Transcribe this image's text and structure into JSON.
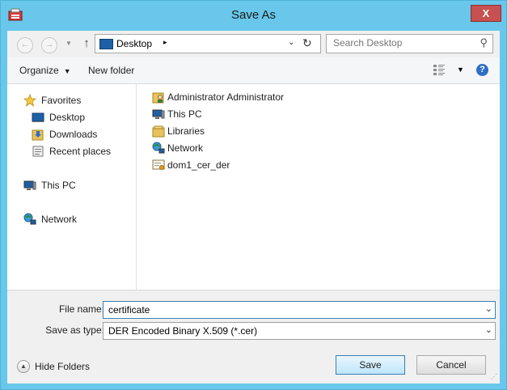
{
  "window": {
    "title": "Save As",
    "close_label": "X"
  },
  "navigation": {
    "back_icon": "back-arrow-icon",
    "forward_icon": "forward-arrow-icon",
    "up_icon": "up-arrow-icon",
    "up_glyph": "↑",
    "address": {
      "location": "Desktop",
      "separator": "▸",
      "dropdown": "⌄",
      "refresh": "↻"
    },
    "search": {
      "placeholder": "Search Desktop",
      "glyph": "⚲"
    }
  },
  "toolbar": {
    "organize_label": "Organize",
    "organize_caret": "▼",
    "new_folder_label": "New folder",
    "view_caret": "▼",
    "help_label": "?"
  },
  "nav_pane": {
    "favorites_label": "Favorites",
    "favorites_items": [
      {
        "label": "Desktop",
        "icon": "desktop-icon"
      },
      {
        "label": "Downloads",
        "icon": "downloads-icon"
      },
      {
        "label": "Recent places",
        "icon": "recent-places-icon"
      }
    ],
    "this_pc_label": "This PC",
    "network_label": "Network"
  },
  "files": [
    {
      "name": "Administrator Administrator",
      "icon": "user-folder-icon"
    },
    {
      "name": "This PC",
      "icon": "computer-icon"
    },
    {
      "name": "Libraries",
      "icon": "libraries-icon"
    },
    {
      "name": "Network",
      "icon": "network-icon"
    },
    {
      "name": "dom1_cer_der",
      "icon": "certificate-file-icon"
    }
  ],
  "save_panel": {
    "file_name_label": "File name:",
    "file_name_value": "certificate",
    "save_as_type_label": "Save as type:",
    "save_as_type_value": "DER Encoded Binary X.509 (*.cer)",
    "dropdown_glyph": "⌄"
  },
  "footer": {
    "hide_folders_label": "Hide Folders",
    "hide_folders_glyph": "▲",
    "save_label": "Save",
    "cancel_label": "Cancel"
  },
  "colors": {
    "frame": "#68c7ea",
    "close": "#c75050",
    "default_button_border": "#3c7fb1"
  }
}
